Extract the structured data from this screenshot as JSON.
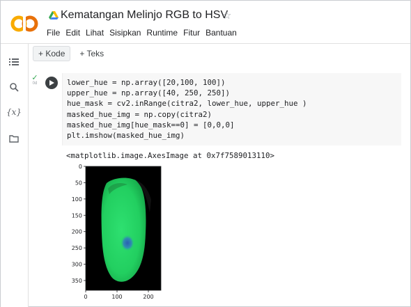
{
  "app": {
    "title": "Kematangan Melinjo RGB to HSV",
    "star_icon": "star-outline-icon",
    "logo": "colab-logo",
    "menu": [
      "File",
      "Edit",
      "Lihat",
      "Sisipkan",
      "Runtime",
      "Fitur",
      "Bantuan"
    ]
  },
  "toolbar": {
    "add_code_label": "+ Kode",
    "add_text_label": "+ Teks"
  },
  "sidebar": {
    "icons": [
      "table-of-contents-icon",
      "search-icon",
      "variables-icon",
      "folder-icon"
    ],
    "variables_label": "{x}"
  },
  "cell": {
    "status_icon": "check-icon",
    "exec_time": "0d",
    "code_lines": [
      "lower_hue = np.array([20,100, 100])",
      "upper_hue = np.array([40, 250, 250])",
      "hue_mask = cv2.inRange(citra2, lower_hue, upper_hue )",
      "masked_hue_img = np.copy(citra2)",
      "masked_hue_img[hue_mask==0] = [0,0,0]",
      "plt.imshow(masked_hue_img)"
    ],
    "output_text": "<matplotlib.image.AxesImage at 0x7f7589013110>"
  },
  "chart_data": {
    "type": "image",
    "xlim": [
      0,
      240
    ],
    "ylim": [
      380,
      0
    ],
    "xticks": [
      0,
      100,
      200
    ],
    "yticks": [
      0,
      50,
      100,
      150,
      200,
      250,
      300,
      350
    ]
  },
  "colors": {
    "accent": "#f9ab00",
    "run_button": "#3c4043",
    "check": "#34a853",
    "object_fill": "#26d86a",
    "spot": "#2e6fbf"
  }
}
